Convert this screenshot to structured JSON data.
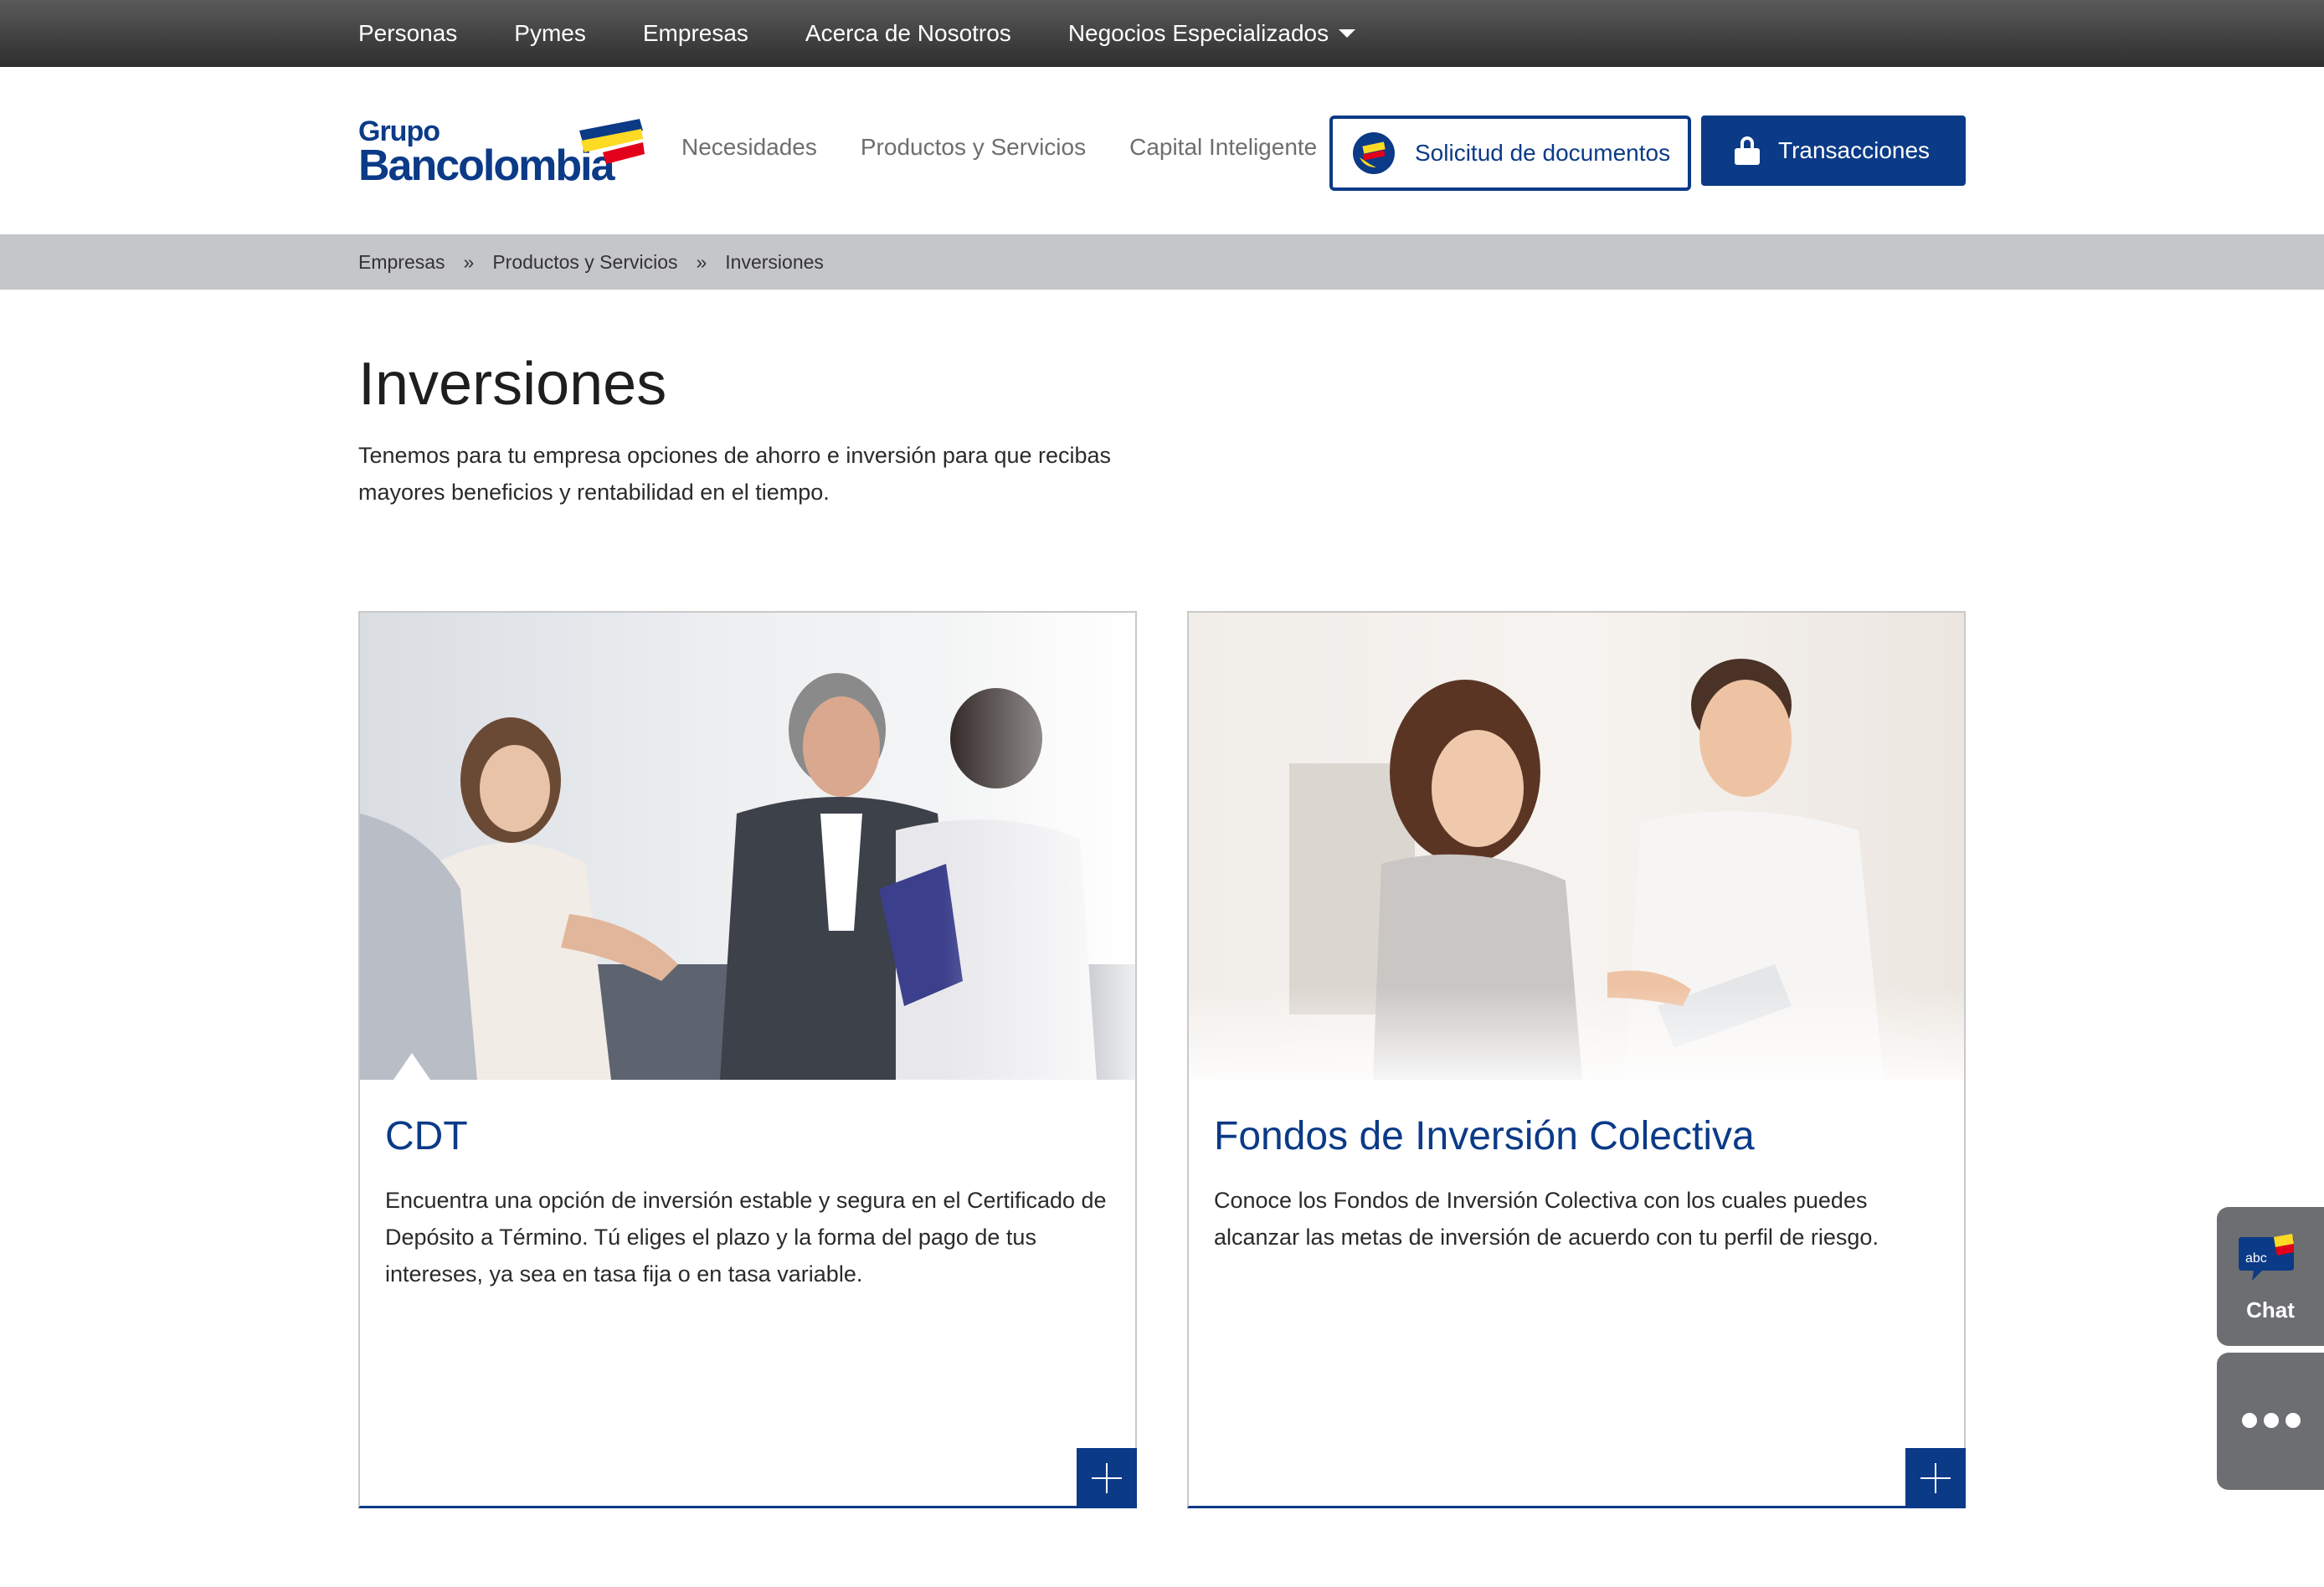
{
  "topnav": {
    "items": [
      "Personas",
      "Pymes",
      "Empresas",
      "Acerca de Nosotros",
      "Negocios Especializados"
    ]
  },
  "brand": {
    "logo_top": "Grupo",
    "logo_main": "Bancolombia",
    "colors": {
      "blue": "#0b3a87",
      "yellow": "#fdda24",
      "red": "#e2001a"
    }
  },
  "mainnav": {
    "items": [
      "Necesidades",
      "Productos y Servicios",
      "Capital Inteligente"
    ],
    "docs_button": "Solicitud de documentos",
    "transactions_button": "Transacciones"
  },
  "breadcrumb": {
    "items": [
      "Empresas",
      "Productos y Servicios",
      "Inversiones"
    ],
    "separator": "»"
  },
  "page": {
    "title": "Inversiones",
    "intro": "Tenemos para tu empresa opciones de ahorro e inversión para que recibas mayores beneficios y rentabilidad en el tiempo."
  },
  "cards": [
    {
      "title": "CDT",
      "text": "Encuentra una opción de inversión estable y segura en el Certificado de Depósito a Término. Tú eliges el plazo y la forma  del pago de tus intereses, ya sea en tasa fija o en tasa variable."
    },
    {
      "title": "Fondos de Inversión Colectiva",
      "text": "Conoce los Fondos de Inversión Colectiva con los cuales puedes alcanzar las metas de inversión de acuerdo con tu perfil de riesgo."
    }
  ],
  "floating": {
    "chat_label": "Chat",
    "chat_badge": "abc"
  }
}
